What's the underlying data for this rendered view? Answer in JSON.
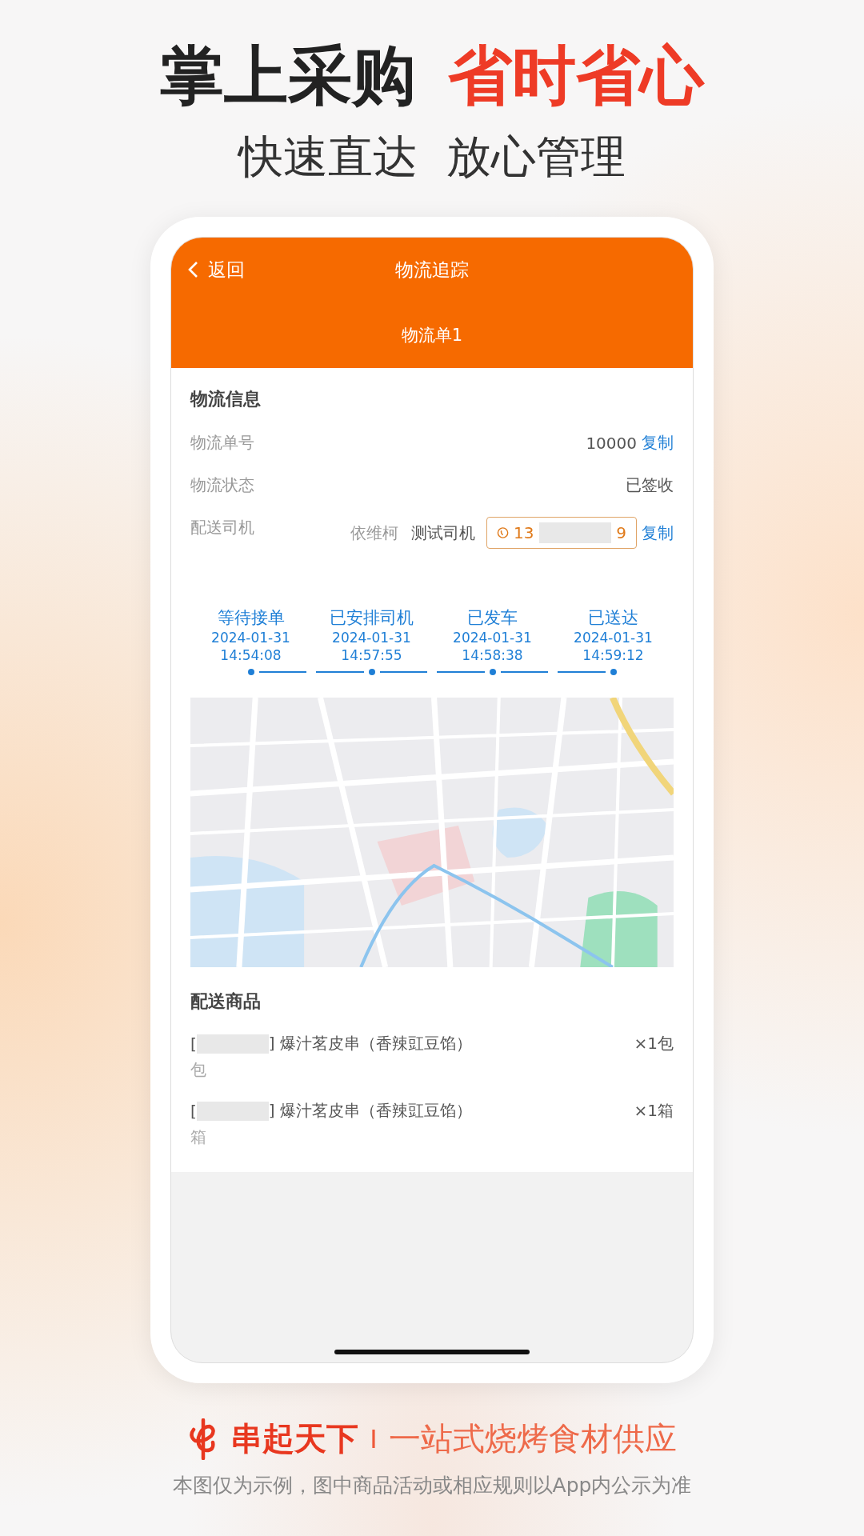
{
  "headline": {
    "lead": "掌上采购",
    "accent": "省时省心"
  },
  "subheadline": [
    "快速直达",
    "放心管理"
  ],
  "phone": {
    "nav": {
      "back": "返回",
      "title": "物流追踪"
    },
    "order_tab": "物流单1",
    "info": {
      "heading": "物流信息",
      "rows": [
        {
          "kind": "copy",
          "label": "物流单号",
          "value": "10000",
          "action": "复制"
        },
        {
          "kind": "plain",
          "label": "物流状态",
          "value": "已签收"
        },
        {
          "kind": "driver",
          "label": "配送司机",
          "vehicle": "依维柯",
          "driver": "测试司机",
          "phone_start": "13",
          "phone_end": "9",
          "action": "复制"
        }
      ]
    },
    "timeline": [
      {
        "label": "等待接单",
        "date": "2024-01-31",
        "time": "14:54:08"
      },
      {
        "label": "已安排司机",
        "date": "2024-01-31",
        "time": "14:57:55"
      },
      {
        "label": "已发车",
        "date": "2024-01-31",
        "time": "14:58:38"
      },
      {
        "label": "已送达",
        "date": "2024-01-31",
        "time": "14:59:12"
      }
    ],
    "goods": {
      "heading": "配送商品",
      "items": [
        {
          "open": "[",
          "name": "] 爆汁茗皮串（香辣豇豆馅）",
          "quantity": "×1包",
          "unit": "包"
        },
        {
          "open": "[",
          "name": "] 爆汁茗皮串（香辣豇豆馅）",
          "quantity": "×1箱",
          "unit": "箱"
        }
      ]
    }
  },
  "footer": {
    "brand": "串起天下",
    "separator": "I",
    "slogan": "一站式烧烤食材供应",
    "disclaimer": "本图仅为示例，图中商品活动或相应规则以App内公示为准"
  }
}
